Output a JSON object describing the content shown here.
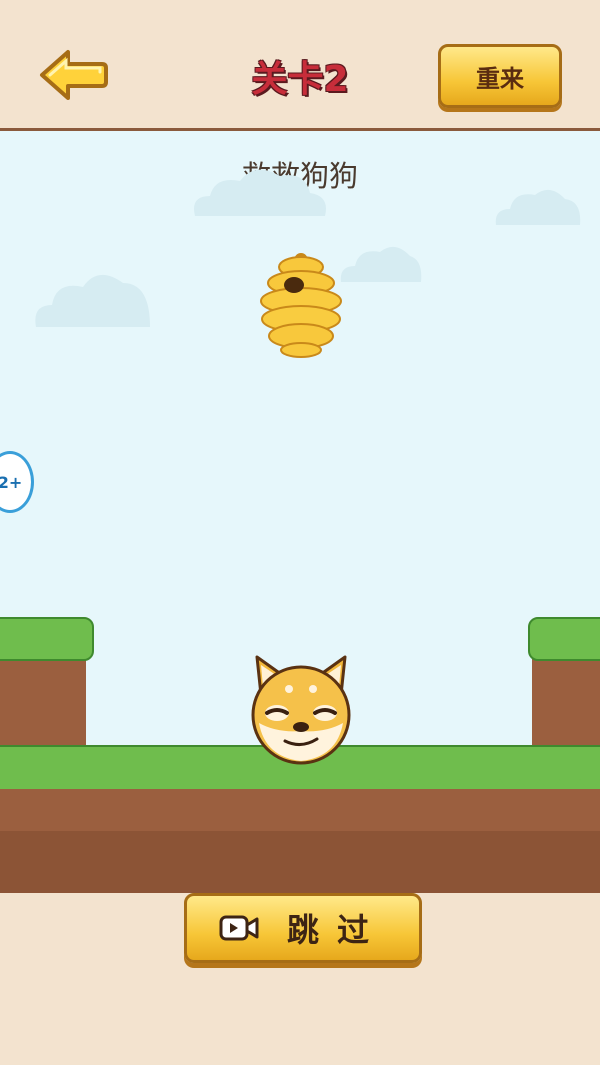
{
  "header": {
    "level_title": "关卡2",
    "restart_label": "重来"
  },
  "scene": {
    "hint": "救救狗狗",
    "side_badge": "2+"
  },
  "footer": {
    "skip_label": "跳过"
  },
  "icons": {
    "back": "back-arrow-icon",
    "video": "video-icon"
  },
  "colors": {
    "title_red": "#c72d3a",
    "button_gold": "#f7c637",
    "sky": "#e6f7fb",
    "grass": "#6fbd4d",
    "dirt": "#9b5f3f"
  }
}
